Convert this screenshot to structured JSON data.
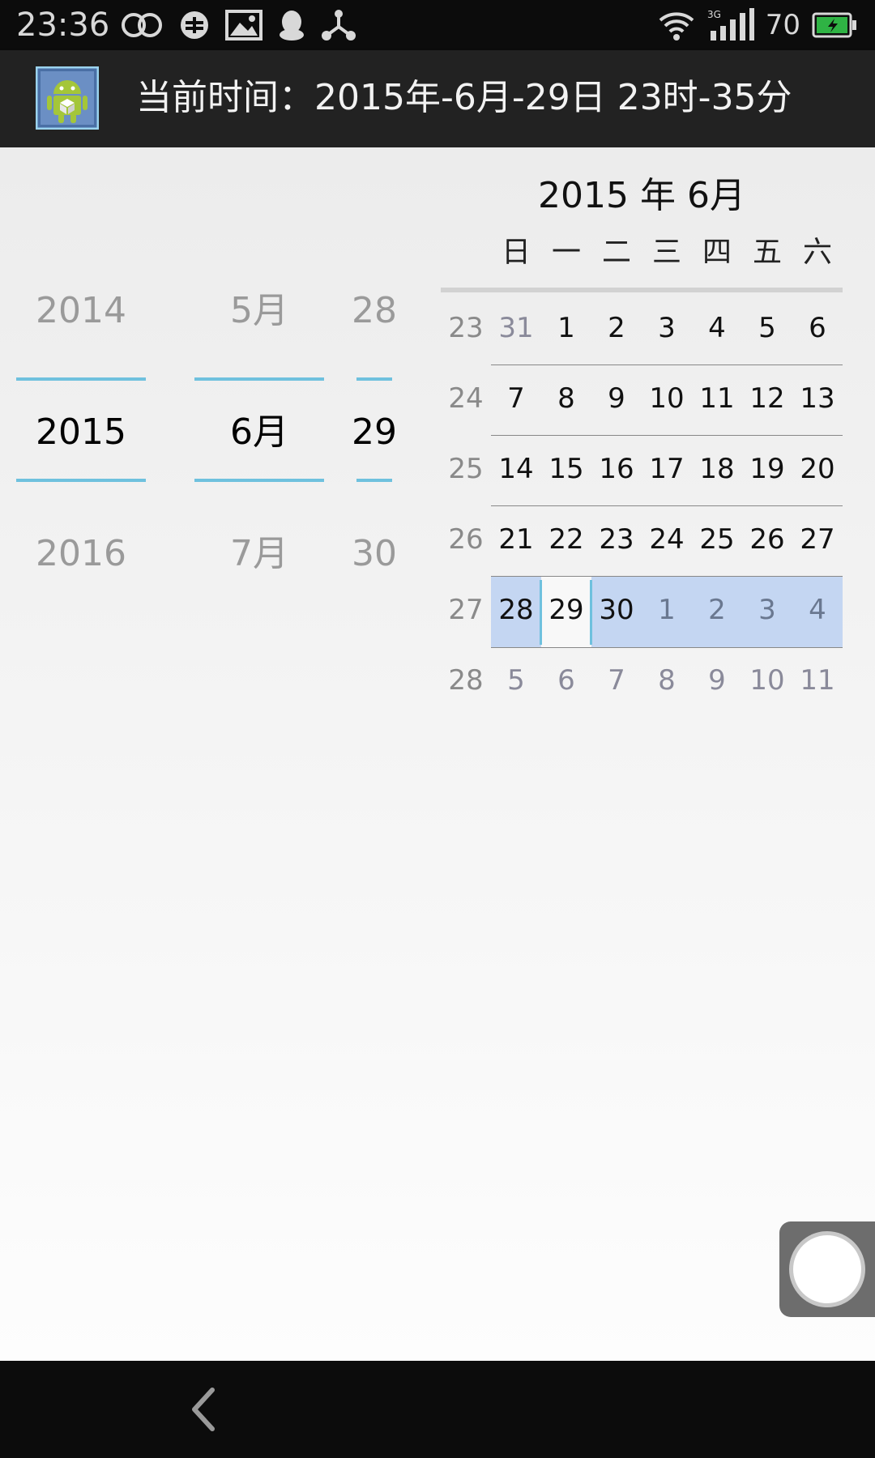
{
  "status_bar": {
    "time": "23:36",
    "battery_percent": "70",
    "left_icons": [
      "infinity-icon",
      "sync-icon",
      "image-icon",
      "qq-icon",
      "share-icon"
    ],
    "right_icons": [
      "wifi-icon",
      "signal-3g-icon",
      "battery-icon"
    ],
    "network_label": "3G",
    "battery_color": "#2fb344"
  },
  "action_bar": {
    "title": "当前时间：2015年-6月-29日 23时-35分",
    "icon": "android-app-icon"
  },
  "date_picker": {
    "year": {
      "prev": "2014",
      "current": "2015",
      "next": "2016"
    },
    "month": {
      "prev": "5月",
      "current": "6月",
      "next": "7月"
    },
    "day": {
      "prev": "28",
      "current": "29",
      "next": "30"
    },
    "accent_color": "#6fc1de"
  },
  "calendar": {
    "header": "2015 年 6月",
    "weekdays": [
      "日",
      "一",
      "二",
      "三",
      "四",
      "五",
      "六"
    ],
    "weeks": [
      {
        "num": "23",
        "days": [
          "31",
          "1",
          "2",
          "3",
          "4",
          "5",
          "6"
        ]
      },
      {
        "num": "24",
        "days": [
          "7",
          "8",
          "9",
          "10",
          "11",
          "12",
          "13"
        ]
      },
      {
        "num": "25",
        "days": [
          "14",
          "15",
          "16",
          "17",
          "18",
          "19",
          "20"
        ]
      },
      {
        "num": "26",
        "days": [
          "21",
          "22",
          "23",
          "24",
          "25",
          "26",
          "27"
        ]
      },
      {
        "num": "27",
        "days": [
          "28",
          "29",
          "30",
          "1",
          "2",
          "3",
          "4"
        ]
      },
      {
        "num": "28",
        "days": [
          "5",
          "6",
          "7",
          "8",
          "9",
          "10",
          "11"
        ]
      }
    ],
    "selected_date": "29",
    "selected_week_color": "#c4d6f2"
  },
  "nav_bar": {
    "back_icon": "back-chevron-icon"
  }
}
